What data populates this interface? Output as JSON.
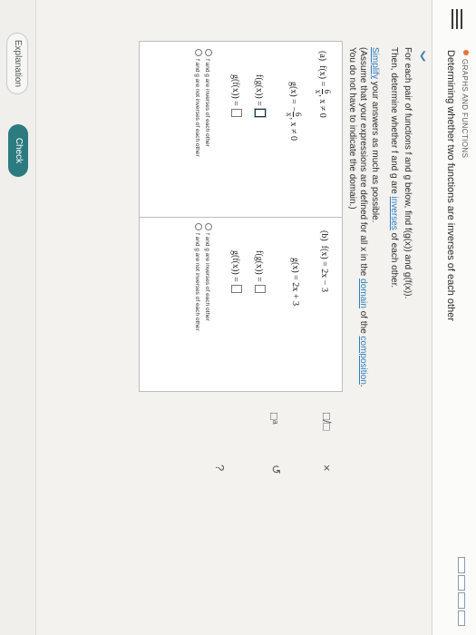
{
  "header": {
    "section": "GRAPHS AND FUNCTIONS",
    "title": "Determining whether two functions are inverses of each other"
  },
  "instructions": {
    "line1": "For each pair of functions f and g below, find f(g(x)) and g(f(x)).",
    "line2_a": "Then, determine whether f and g are ",
    "line2_link": "inverses",
    "line2_b": " of each other.",
    "line3_link": "Simplify",
    "line3_b": " your answers as much as possible.",
    "line4_a": "(Assume that your expressions are defined for all x in the ",
    "line4_link1": "domain",
    "line4_b": " of the ",
    "line4_link2": "composition",
    "line4_c": ".",
    "line5": "You do not have to indicate the domain.)"
  },
  "part_a": {
    "label": "(a)",
    "f_lhs": "f(x) =",
    "f_num": "6",
    "f_den": "x",
    "f_cond": ", x ≠ 0",
    "g_lhs": "g(x) =",
    "g_sign": "−",
    "g_num": "6",
    "g_den": "x",
    "g_cond": ", x ≠ 0",
    "fg_label": "f(g(x)) =",
    "gf_label": "g(f(x)) =",
    "opt_inverse": "f and g are inverses of each other",
    "opt_not_inverse": "f and g are not inverses of each other"
  },
  "part_b": {
    "label": "(b)",
    "f_def": "f(x) = 2x − 3",
    "g_def": "g(x) = 2x + 3",
    "fg_label": "f(g(x)) =",
    "gf_label": "g(f(x)) =",
    "opt_inverse": "f and g are inverses of each other",
    "opt_not_inverse": "f and g are not inverses of each other"
  },
  "tools": {
    "fraction": "□/□",
    "exponent": "□ᵃ",
    "clear": "×",
    "undo": "↺",
    "help": "?"
  },
  "footer": {
    "explanation": "Explanation",
    "check": "Check"
  }
}
